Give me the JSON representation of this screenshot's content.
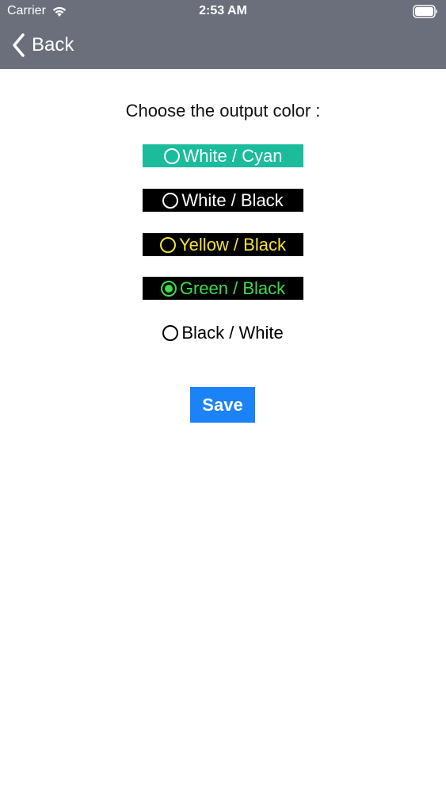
{
  "status_bar": {
    "carrier": "Carrier",
    "time": "2:53 AM"
  },
  "nav": {
    "back_label": "Back",
    "bar_color": "#6b6f7b"
  },
  "prompt": "Choose the output color :",
  "options": [
    {
      "label": "White / Cyan",
      "text_color": "#ffffff",
      "bg_color": "#1abc9c",
      "selected": false
    },
    {
      "label": "White / Black",
      "text_color": "#ffffff",
      "bg_color": "#000000",
      "selected": false
    },
    {
      "label": "Yellow / Black",
      "text_color": "#f6e03b",
      "bg_color": "#000000",
      "selected": false
    },
    {
      "label": "Green / Black",
      "text_color": "#3bdc4a",
      "bg_color": "#000000",
      "selected": true
    },
    {
      "label": "Black / White",
      "text_color": "#000000",
      "bg_color": "#ffffff",
      "selected": false
    }
  ],
  "save_label": "Save",
  "accent_color": "#1b82f8"
}
